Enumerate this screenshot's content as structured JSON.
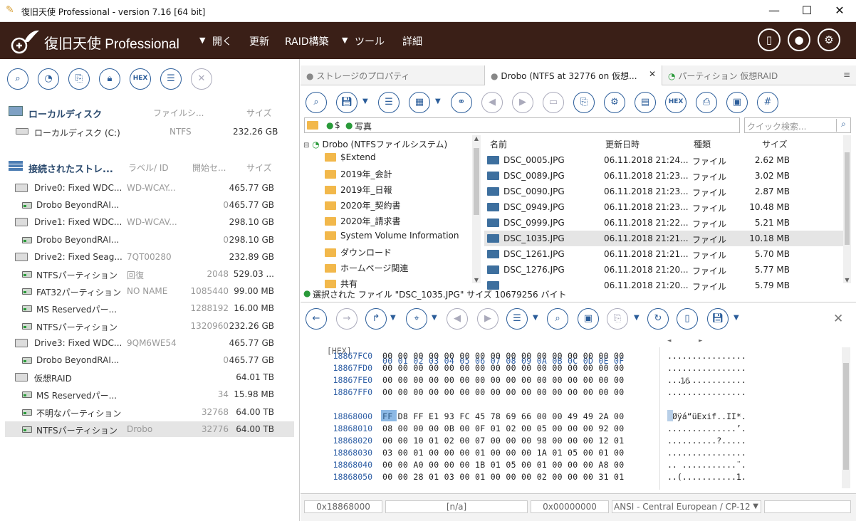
{
  "window": {
    "title": "復旧天使 Professional - version 7.16 [64 bit]",
    "min": "—",
    "max": "☐",
    "close": "✕"
  },
  "header": {
    "brand": "復旧天使",
    "brand2": "Professional",
    "menu": [
      "開く",
      "更新",
      "RAID構築",
      "ツール",
      "詳細"
    ]
  },
  "left": {
    "local_header": "ローカルディスク",
    "local_col_fs": "ファイルシ...",
    "local_col_size": "サイズ",
    "local_disk": {
      "name": "ローカルディスク (C:)",
      "fs": "NTFS",
      "size": "232.26 GB"
    },
    "storage_header": "接続されたストレ...",
    "st_col_label": "ラベル/ ID",
    "st_col_start": "開始セ...",
    "st_col_size": "サイズ",
    "items": [
      {
        "type": "drive",
        "name": "Drive0: Fixed WDC...",
        "label": "WD-WCAY...",
        "start": "",
        "size": "465.77 GB"
      },
      {
        "type": "part",
        "name": "Drobo BeyondRAI...",
        "label": "",
        "start": "0",
        "size": "465.77 GB"
      },
      {
        "type": "drive",
        "name": "Drive1: Fixed WDC...",
        "label": "WD-WCAV...",
        "start": "",
        "size": "298.10 GB"
      },
      {
        "type": "part",
        "name": "Drobo BeyondRAI...",
        "label": "",
        "start": "0",
        "size": "298.10 GB"
      },
      {
        "type": "drive",
        "name": "Drive2: Fixed Seag...",
        "label": "7QT00280",
        "start": "",
        "size": "232.89 GB"
      },
      {
        "type": "part",
        "name": "NTFSパーティション",
        "label": "回復",
        "start": "2048",
        "size": "529.03 ..."
      },
      {
        "type": "part",
        "name": "FAT32パーティション",
        "label": "NO NAME",
        "start": "1085440",
        "size": "99.00 MB"
      },
      {
        "type": "part",
        "name": "MS Reservedパー...",
        "label": "",
        "start": "1288192",
        "size": "16.00 MB"
      },
      {
        "type": "part",
        "name": "NTFSパーティション",
        "label": "",
        "start": "1320960",
        "size": "232.26 GB"
      },
      {
        "type": "drive",
        "name": "Drive3: Fixed WDC...",
        "label": "9QM6WE54",
        "start": "",
        "size": "465.77 GB"
      },
      {
        "type": "part",
        "name": "Drobo BeyondRAI...",
        "label": "",
        "start": "0",
        "size": "465.77 GB"
      },
      {
        "type": "drive",
        "name": "仮想RAID",
        "label": "",
        "start": "",
        "size": "64.01 TB"
      },
      {
        "type": "part",
        "name": "MS Reservedパー...",
        "label": "",
        "start": "34",
        "size": "15.98 MB"
      },
      {
        "type": "part",
        "name": "不明なパーティション",
        "label": "",
        "start": "32768",
        "size": "64.00 TB"
      },
      {
        "type": "part",
        "name": "NTFSパーティション",
        "label": "Drobo",
        "start": "32776",
        "size": "64.00 TB"
      }
    ]
  },
  "tabs": [
    {
      "label": "ストレージのプロパティ"
    },
    {
      "label": "Drobo (NTFS at 32776 on 仮想..."
    },
    {
      "label": "パーティション 仮想RAID"
    }
  ],
  "path": {
    "seg1": "$",
    "seg2": "写真"
  },
  "search": {
    "placeholder": "クイック検索..."
  },
  "tree": {
    "root": "Drobo (NTFSファイルシステム)",
    "folders": [
      "$Extend",
      "2019年_会計",
      "2019年_日報",
      "2020年_契約書",
      "2020年_請求書",
      "System Volume Information",
      "ダウンロード",
      "ホームページ関連",
      "共有"
    ]
  },
  "files": {
    "cols": {
      "name": "名前",
      "date": "更新日時",
      "kind": "種類",
      "size": "サイズ"
    },
    "rows": [
      {
        "name": "DSC_0005.JPG",
        "date": "06.11.2018 21:24...",
        "kind": "ファイル",
        "size": "2.62 MB"
      },
      {
        "name": "DSC_0089.JPG",
        "date": "06.11.2018 21:23...",
        "kind": "ファイル",
        "size": "3.02 MB"
      },
      {
        "name": "DSC_0090.JPG",
        "date": "06.11.2018 21:23...",
        "kind": "ファイル",
        "size": "2.87 MB"
      },
      {
        "name": "DSC_0949.JPG",
        "date": "06.11.2018 21:23...",
        "kind": "ファイル",
        "size": "10.48 MB"
      },
      {
        "name": "DSC_0999.JPG",
        "date": "06.11.2018 21:22...",
        "kind": "ファイル",
        "size": "5.21 MB"
      },
      {
        "name": "DSC_1035.JPG",
        "date": "06.11.2018 21:21...",
        "kind": "ファイル",
        "size": "10.18 MB"
      },
      {
        "name": "DSC_1261.JPG",
        "date": "06.11.2018 21:21...",
        "kind": "ファイル",
        "size": "5.70 MB"
      },
      {
        "name": "DSC_1276.JPG",
        "date": "06.11.2018 21:20...",
        "kind": "ファイル",
        "size": "5.77 MB"
      },
      {
        "name": "",
        "date": "06.11.2018 21:20...",
        "kind": "ファイル",
        "size": "5.79 MB"
      }
    ]
  },
  "status": "選択された ファイル \"DSC_1035.JPG\" サイズ 10679256 バイト",
  "hex": {
    "header_label": "[HEX]",
    "cols": "00 01 02 03 04 05 06 07 08 09 0A 0B 0C 0D 0E 0F",
    "page": "16",
    "rows": [
      {
        "addr": "18867FC0",
        "bytes": "00 00 00 00 00 00 00 00 00 00 00 00 00 00 00 00",
        "ascii": "................"
      },
      {
        "addr": "18867FD0",
        "bytes": "00 00 00 00 00 00 00 00 00 00 00 00 00 00 00 00",
        "ascii": "................"
      },
      {
        "addr": "18867FE0",
        "bytes": "00 00 00 00 00 00 00 00 00 00 00 00 00 00 00 00",
        "ascii": "................"
      },
      {
        "addr": "18867FF0",
        "bytes": "00 00 00 00 00 00 00 00 00 00 00 00 00 00 00 00",
        "ascii": "................"
      },
      {
        "addr": "18868000",
        "bytes": "FF D8 FF E1 93 FC 45 78 69 66 00 00 49 49 2A 00",
        "ascii": "ÿØÿá“üExif..II*."
      },
      {
        "addr": "18868010",
        "bytes": "08 00 00 00 0B 00 0F 01 02 00 05 00 00 00 92 00",
        "ascii": "..............’."
      },
      {
        "addr": "18868020",
        "bytes": "00 00 10 01 02 00 07 00 00 00 98 00 00 00 12 01",
        "ascii": "..........?....."
      },
      {
        "addr": "18868030",
        "bytes": "03 00 01 00 00 00 01 00 00 00 1A 01 05 00 01 00",
        "ascii": "................"
      },
      {
        "addr": "18868040",
        "bytes": "00 00 A0 00 00 00 1B 01 05 00 01 00 00 00 A8 00",
        "ascii": ".. ...........¨."
      },
      {
        "addr": "18868050",
        "bytes": "00 00 28 01 03 00 01 00 00 00 02 00 00 00 31 01",
        "ascii": "..(...........1."
      }
    ]
  },
  "footer": {
    "offset": "0x18868000",
    "na": "[n/a]",
    "val": "0x00000000",
    "encoding": "ANSI - Central European / CP-12"
  },
  "colors": {
    "header_bg": "#3a1f17",
    "accent": "#2b5d9a",
    "selection": "#2f7fd0"
  }
}
